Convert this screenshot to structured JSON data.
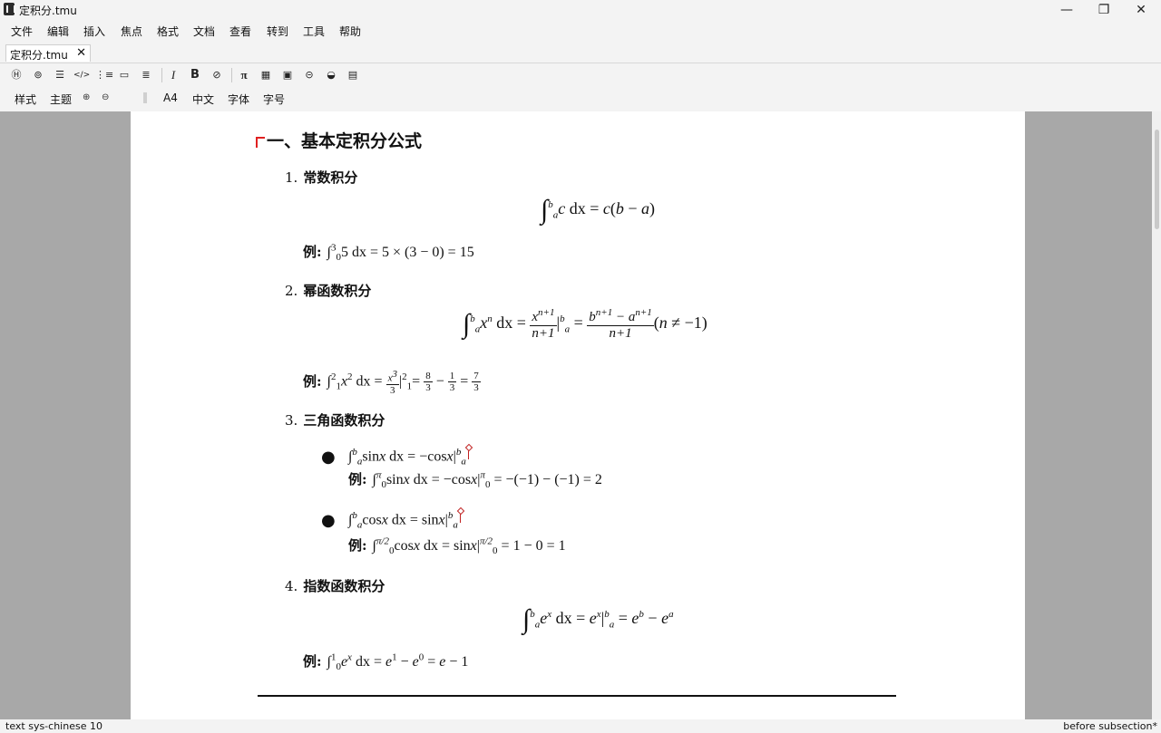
{
  "window": {
    "title": "定积分.tmu",
    "min_label": "—",
    "restore_label": "❐",
    "close_label": "✕"
  },
  "menu": [
    "文件",
    "编辑",
    "插入",
    "焦点",
    "格式",
    "文档",
    "查看",
    "转到",
    "工具",
    "帮助"
  ],
  "tab": {
    "label": "定积分.tmu",
    "close": "✕"
  },
  "toolbar": {
    "icons": [
      "section-icon",
      "location-icon",
      "list-icon",
      "code-icon",
      "list-indent-icon",
      "comment-icon",
      "align-icon",
      "italic-icon",
      "bold-icon",
      "link-chain-icon",
      "pi-icon",
      "table-icon",
      "image-icon",
      "link-icon",
      "tag-icon",
      "frame-icon"
    ],
    "glyphs": [
      "Ⓗ",
      "⊚",
      "☰",
      "</>",
      "⋮≡",
      "▭",
      "≣",
      "I",
      "B",
      "⊘",
      "π",
      "▦",
      "▣",
      "⊝",
      "◒",
      "▤"
    ]
  },
  "toolbar2": {
    "style": "样式",
    "theme": "主题",
    "zoom_in_icon": "⊕",
    "zoom_out_icon": "⊖",
    "paper": "A4",
    "lang": "中文",
    "font": "字体",
    "size": "字号"
  },
  "doc": {
    "h1": "一、基本定积分公式",
    "s1": {
      "num": "1.",
      "title": "常数积分",
      "example_label": "例:"
    },
    "s2": {
      "num": "2.",
      "title": "幂函数积分",
      "example_label": "例:"
    },
    "s3": {
      "num": "3.",
      "title": "三角函数积分",
      "example_label": "例:"
    },
    "s4": {
      "num": "4.",
      "title": "指数函数积分",
      "example_label": "例:"
    }
  },
  "status": {
    "left": "text sys-chinese 10",
    "right": "before subsection*"
  }
}
